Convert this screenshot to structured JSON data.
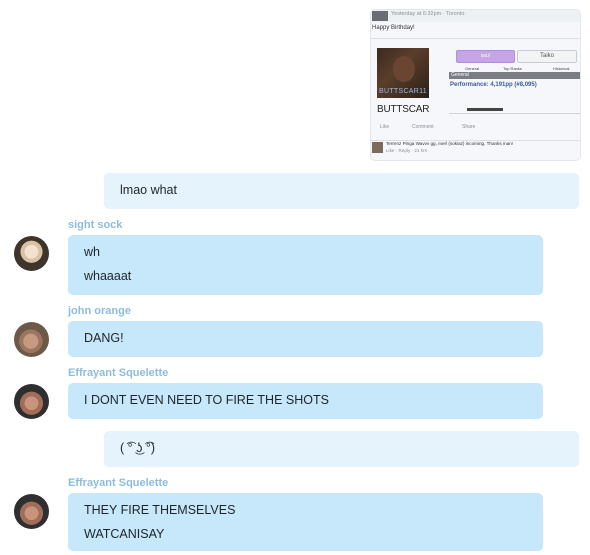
{
  "shared_image": {
    "header_text": "Yesterday at 6:32pm · Toronto",
    "greeting": "Happy Birthday!",
    "profile_banner_text": "BUTTSCAR11",
    "profile_name": "BUTTSCAR",
    "mode_tabs": [
      "osu!",
      "Taiko"
    ],
    "columns": [
      "General",
      "Top Ranks",
      "Historical"
    ],
    "section_bar": "General",
    "performance": "Performance: 4,191pp (#8,095)",
    "actions": [
      "Like",
      "Comment",
      "Share"
    ],
    "comment_text": "Terrenz Pinga Wavvv gg, merl (sokiaz) incoming. Thanks man!",
    "comment_meta": "Like · Reply · 21 hrs"
  },
  "messages": [
    {
      "lines": [
        "lmao what"
      ]
    },
    {
      "sender": "sight sock",
      "lines": [
        "wh",
        "whaaaat"
      ]
    },
    {
      "sender": "john orange",
      "lines": [
        "DANG!"
      ]
    },
    {
      "sender": "Effrayant Squelette",
      "lines": [
        "I DONT EVEN NEED TO FIRE THE SHOTS"
      ]
    },
    {
      "lines": [
        "( ͡° ͜ʖ ͡°)"
      ]
    },
    {
      "sender": "Effrayant Squelette",
      "lines": [
        "THEY FIRE THEMSELVES",
        "WATCANISAY"
      ]
    }
  ]
}
